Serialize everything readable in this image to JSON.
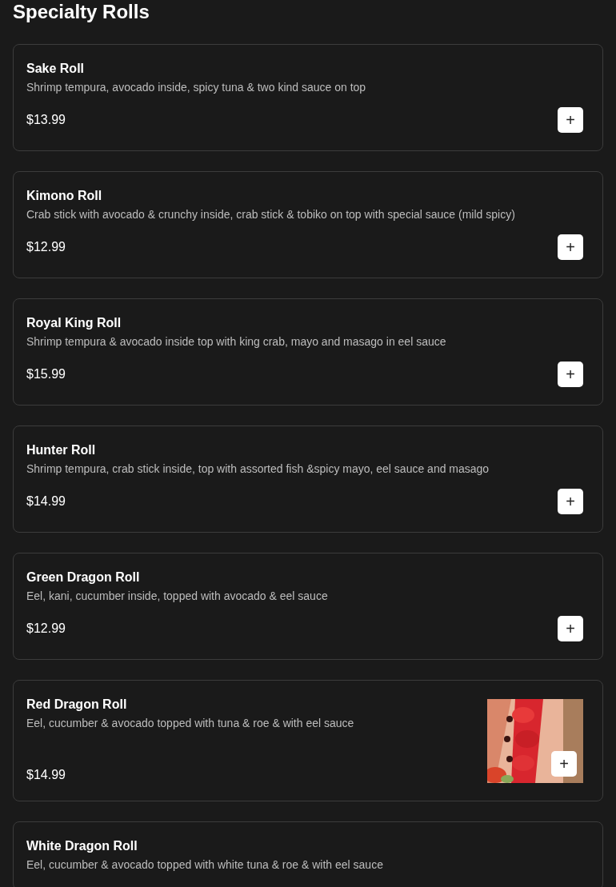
{
  "section_title": "Specialty Rolls",
  "items": [
    {
      "name": "Sake Roll",
      "description": "Shrimp tempura, avocado inside, spicy tuna & two kind sauce on top",
      "price": "$13.99",
      "add_label": "+",
      "has_picture": false
    },
    {
      "name": "Kimono Roll",
      "description": "Crab stick with avocado & crunchy inside, crab stick & tobiko on top with special sauce (mild spicy)",
      "price": "$12.99",
      "add_label": "+",
      "has_picture": false
    },
    {
      "name": "Royal King Roll",
      "description": "Shrimp tempura & avocado inside top with king crab, mayo and masago in eel sauce",
      "price": "$15.99",
      "add_label": "+",
      "has_picture": false
    },
    {
      "name": "Hunter Roll",
      "description": "Shrimp tempura, crab stick inside, top with assorted fish &spicy mayo, eel sauce and masago",
      "price": "$14.99",
      "add_label": "+",
      "has_picture": false
    },
    {
      "name": "Green Dragon Roll",
      "description": "Eel, kani, cucumber inside, topped with avocado & eel sauce",
      "price": "$12.99",
      "add_label": "+",
      "has_picture": false
    },
    {
      "name": "Red Dragon Roll",
      "description": "Eel, cucumber & avocado topped with tuna & roe & with eel sauce",
      "price": "$14.99",
      "add_label": "+",
      "has_picture": true
    },
    {
      "name": "White Dragon Roll",
      "description": "Eel, cucumber & avocado topped with white tuna & roe & with eel sauce",
      "has_picture": false
    }
  ]
}
